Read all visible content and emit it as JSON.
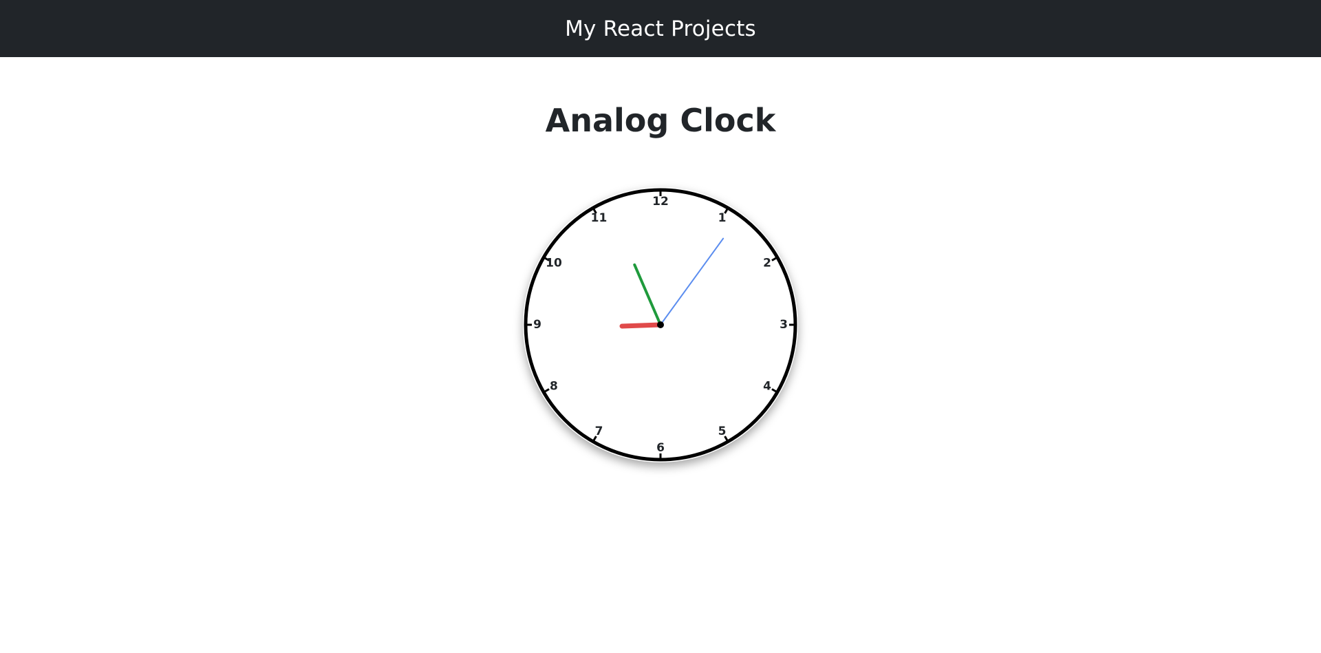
{
  "navbar": {
    "title": "My React Projects"
  },
  "page": {
    "title": "Analog Clock"
  },
  "clock": {
    "numbers": [
      "12",
      "1",
      "2",
      "3",
      "4",
      "5",
      "6",
      "7",
      "8",
      "9",
      "10",
      "11"
    ],
    "time": {
      "hours": 8,
      "minutes": 56,
      "seconds": 6
    },
    "colors": {
      "background": "#212529",
      "face": "#ffffff",
      "rim": "#000000",
      "hour_hand": "#e04a4a",
      "minute_hand": "#1f9a3c",
      "second_hand": "#5b8def",
      "center_dot": "#000000"
    },
    "hands": [
      "hour-hand",
      "minute-hand",
      "second-hand"
    ]
  }
}
